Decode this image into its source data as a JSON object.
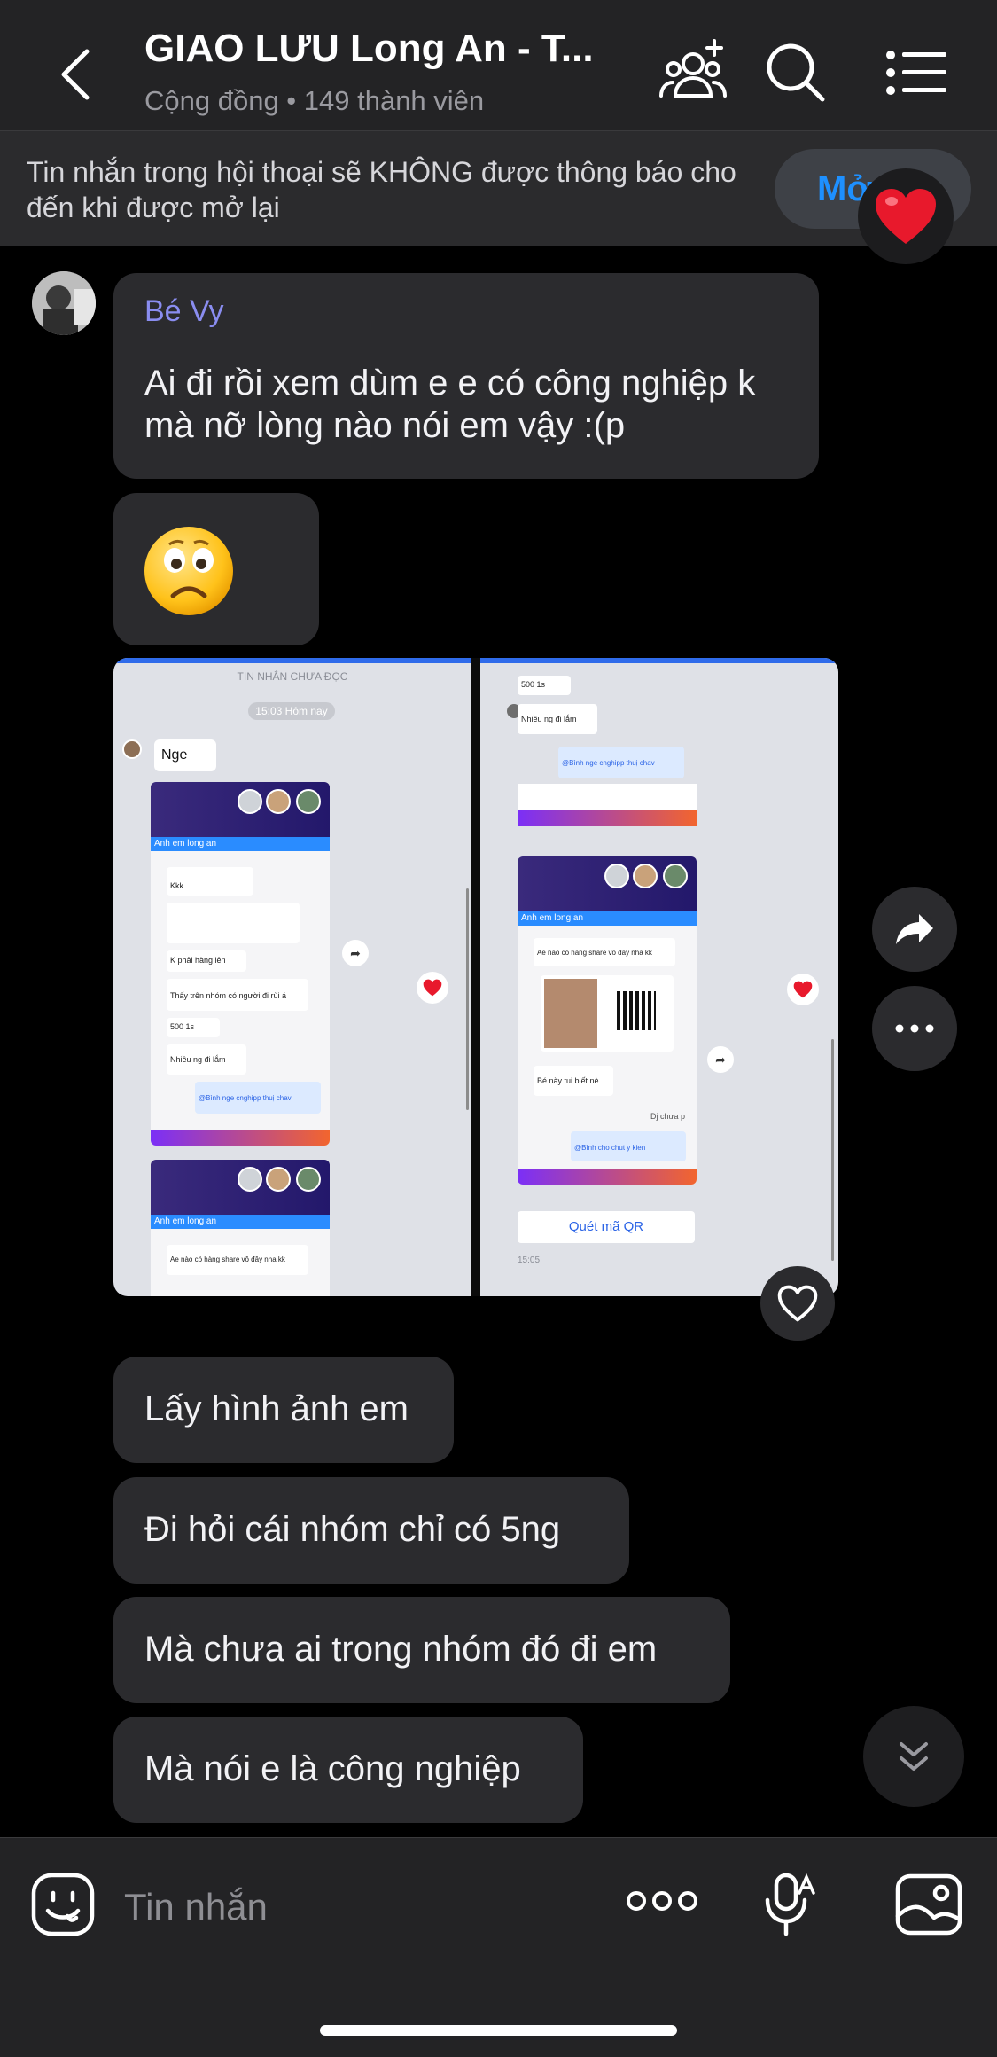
{
  "header": {
    "title": "GIAO LƯU Long An - T...",
    "subtitle": "Cộng đồng • 149 thành viên"
  },
  "notice": {
    "text": "Tin nhắn trong hội thoại sẽ KHÔNG được thông báo cho đến khi được mở lại",
    "button_label": "Mở"
  },
  "messages": {
    "sender": "Bé Vy",
    "m1": "Ai đi rồi xem dùm e e có công nghiệp k mà nỡ lòng nào nói em vậy :(p",
    "m3": "Lấy hình ảnh em",
    "m4": "Đi hỏi cái nhóm chỉ có 5ng",
    "m5": "Mà chưa ai trong nhóm đó đi em",
    "m6": "Mà nói e là công nghiệp"
  },
  "screenshot_left": {
    "unread_label": "TIN NHẮN CHƯA ĐỌC",
    "time_label": "15:03 Hôm nay",
    "nge": "Nge",
    "group_name": "Anh em long an",
    "line1": "Kkk",
    "line2": "K phải hàng lên",
    "line3": "Thấy trên nhóm có người đi rùi á",
    "line4": "500 1s",
    "line5": "Nhiều ng đi lắm",
    "line6": "@Bình nge cnghipp thuị chav",
    "line7": "Ae nào có hàng share vô đây nha kk"
  },
  "screenshot_right": {
    "line1": "500 1s",
    "line2": "Nhiều ng đi lắm",
    "line3": "@Bình nge cnghipp thuị chav",
    "group_name": "Anh em long an",
    "line4": "Ae nào có hàng share vô đây nha kk",
    "line5": "Bé này tui biết nè",
    "line6": "Dj chưa p",
    "line7": "@Bình cho chut y kien",
    "qr_label": "Quét mã QR",
    "time": "15:05"
  },
  "input": {
    "placeholder": "Tin nhắn"
  },
  "colors": {
    "accent": "#1e90ff",
    "sender_name": "#8a8df0",
    "bubble": "#2b2b2e",
    "heart": "#e8192c"
  }
}
